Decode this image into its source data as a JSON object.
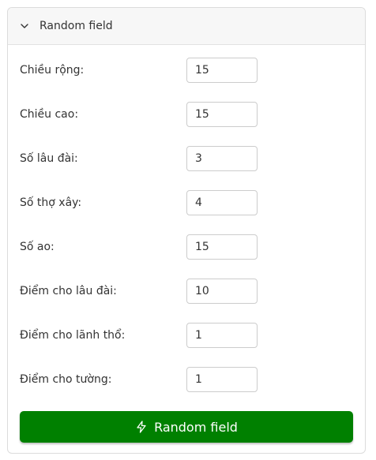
{
  "panel": {
    "title": "Random field",
    "expanded": true,
    "chevron_icon": "chevron-down-icon"
  },
  "fields": [
    {
      "label": "Chiều rộng:",
      "value": "15"
    },
    {
      "label": "Chiều cao:",
      "value": "15"
    },
    {
      "label": "Số lâu đài:",
      "value": "3"
    },
    {
      "label": "Số thợ xây:",
      "value": "4"
    },
    {
      "label": "Số ao:",
      "value": "15"
    },
    {
      "label": "Điểm cho lâu đài:",
      "value": "10"
    },
    {
      "label": "Điểm cho lãnh thổ:",
      "value": "1"
    },
    {
      "label": "Điểm cho tường:",
      "value": "1"
    }
  ],
  "action": {
    "label": "Random field",
    "icon": "lightning-bolt-icon",
    "color": "#008000"
  }
}
